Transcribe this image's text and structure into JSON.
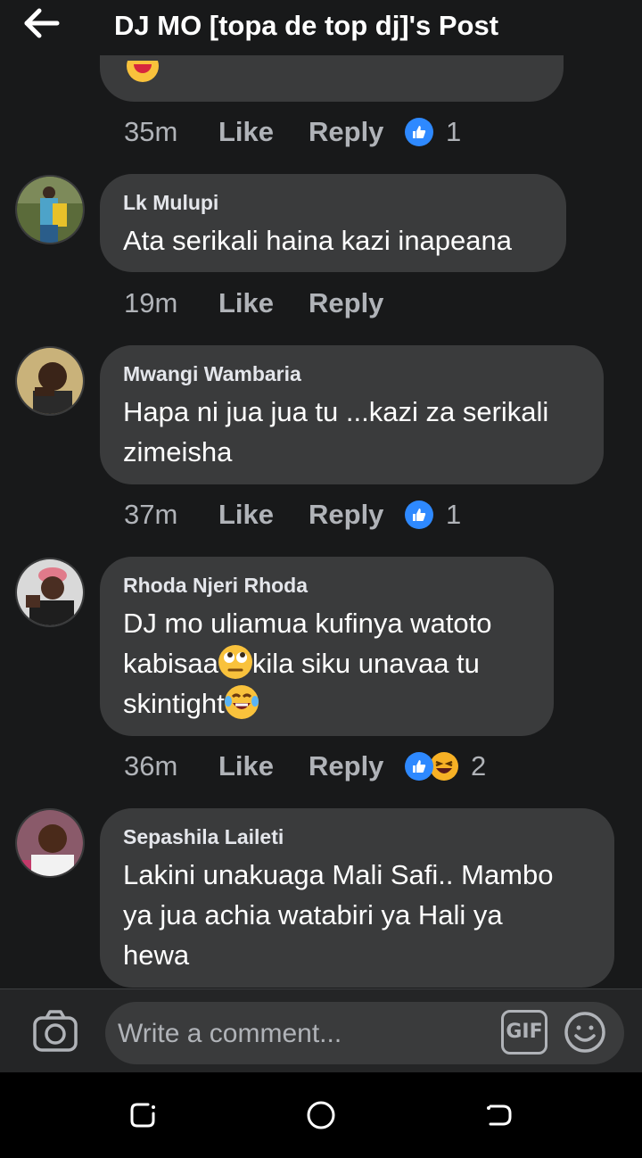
{
  "header": {
    "title": "DJ MO [topa de top dj]'s Post"
  },
  "previous_comment": {
    "time": "35m",
    "like_label": "Like",
    "reply_label": "Reply",
    "reaction_count": "1"
  },
  "comments": [
    {
      "author": "Lk Mulupi",
      "lines": [
        "Ata serikali haina kazi inapeana"
      ],
      "time": "19m",
      "like_label": "Like",
      "reply_label": "Reply",
      "reaction_count": ""
    },
    {
      "author": "Mwangi Wambaria",
      "lines": [
        "Hapa ni jua jua tu ...kazi za serikali",
        "zimeisha"
      ],
      "time": "37m",
      "like_label": "Like",
      "reply_label": "Reply",
      "reaction_count": "1"
    },
    {
      "author": "Rhoda Njeri Rhoda",
      "lines": [
        "DJ mo uliamua kufinya watoto",
        "kabisaa",
        "kila siku unavaa tu",
        "skintight"
      ],
      "time": "36m",
      "like_label": "Like",
      "reply_label": "Reply",
      "reaction_count": "2"
    },
    {
      "author": "Sepashila Laileti",
      "lines": [
        "Lakini unakuaga Mali Safi.. Mambo",
        "ya jua achia watabiri ya Hali ya",
        "hewa"
      ],
      "time": "",
      "like_label": "",
      "reply_label": "",
      "reaction_count": ""
    }
  ],
  "composer": {
    "placeholder": "Write a comment...",
    "gif_label": "GIF"
  },
  "colors": {
    "background": "#18191a",
    "bubble": "#3a3b3c",
    "like_blue": "#2e89ff",
    "emoji_yellow": "#f9c23c"
  },
  "icons": [
    "back-arrow-icon",
    "like-reaction-icon",
    "haha-reaction-icon",
    "camera-icon",
    "gif-icon",
    "emoji-icon",
    "recent-apps-icon",
    "home-icon",
    "back-nav-icon"
  ]
}
